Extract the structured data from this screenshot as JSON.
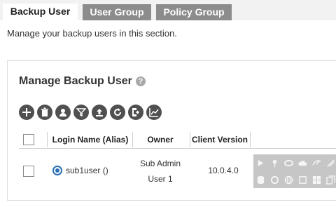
{
  "tabs": [
    {
      "label": "Backup User",
      "active": true
    },
    {
      "label": "User Group",
      "active": false
    },
    {
      "label": "Policy Group",
      "active": false
    }
  ],
  "description": "Manage your backup users in this section.",
  "panel": {
    "title": "Manage Backup User",
    "help_icon": "?",
    "toolbar": [
      {
        "icon": "add-icon"
      },
      {
        "icon": "trash-icon"
      },
      {
        "icon": "user-settings-icon"
      },
      {
        "icon": "filter-icon"
      },
      {
        "icon": "upload-icon"
      },
      {
        "icon": "restore-icon"
      },
      {
        "icon": "export-icon"
      },
      {
        "icon": "chart-icon"
      }
    ]
  },
  "table": {
    "columns": [
      "Login Name (Alias)",
      "Owner",
      "Client Version"
    ],
    "rows": [
      {
        "login": "sub1user ()",
        "owner_line1": "Sub Admin",
        "owner_line2": "User 1",
        "client_version": "10.0.4.0",
        "feature_icons": [
          "exchange-icon",
          "pin-icon",
          "oracle-icon",
          "cloud-icon",
          "mysql-icon",
          "lotus-icon",
          "database-icon",
          "sync-icon",
          "globe-icon",
          "hyperv-icon",
          "windows-icon",
          "copy-icon"
        ]
      }
    ]
  },
  "colors": {
    "tab_inactive": "#8c8c8c",
    "accent": "#2a6fb5",
    "toolbar_button": "#505050",
    "feature_bg": "#c6c6c6"
  }
}
